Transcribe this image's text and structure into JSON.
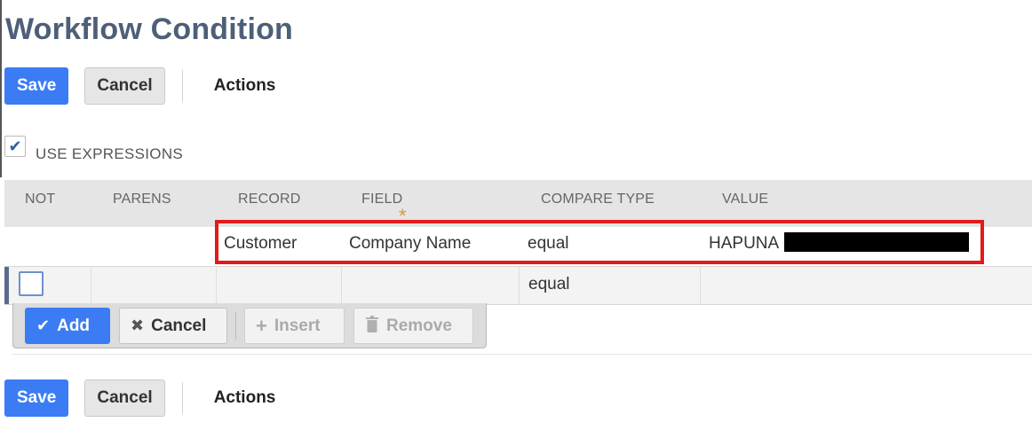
{
  "page": {
    "title": "Workflow Condition"
  },
  "toolbar_top": {
    "save_label": "Save",
    "cancel_label": "Cancel",
    "actions_label": "Actions"
  },
  "toolbar_bottom": {
    "save_label": "Save",
    "cancel_label": "Cancel",
    "actions_label": "Actions"
  },
  "use_expressions": {
    "label": "USE EXPRESSIONS",
    "checked": true
  },
  "grid": {
    "columns": [
      "NOT",
      "PARENS",
      "RECORD",
      "FIELD",
      "COMPARE TYPE",
      "VALUE"
    ],
    "rows": [
      {
        "record": "Customer",
        "field": "Company Name",
        "compare_type": "equal",
        "value": "HAPUNA"
      }
    ],
    "edit_row": {
      "compare_type": "equal"
    }
  },
  "edit_buttons": {
    "add": "Add",
    "cancel": "Cancel",
    "insert": "Insert",
    "remove": "Remove"
  },
  "colors": {
    "primary": "#3b7cf4",
    "title": "#4d5f79",
    "highlight": "#e21b1b"
  }
}
